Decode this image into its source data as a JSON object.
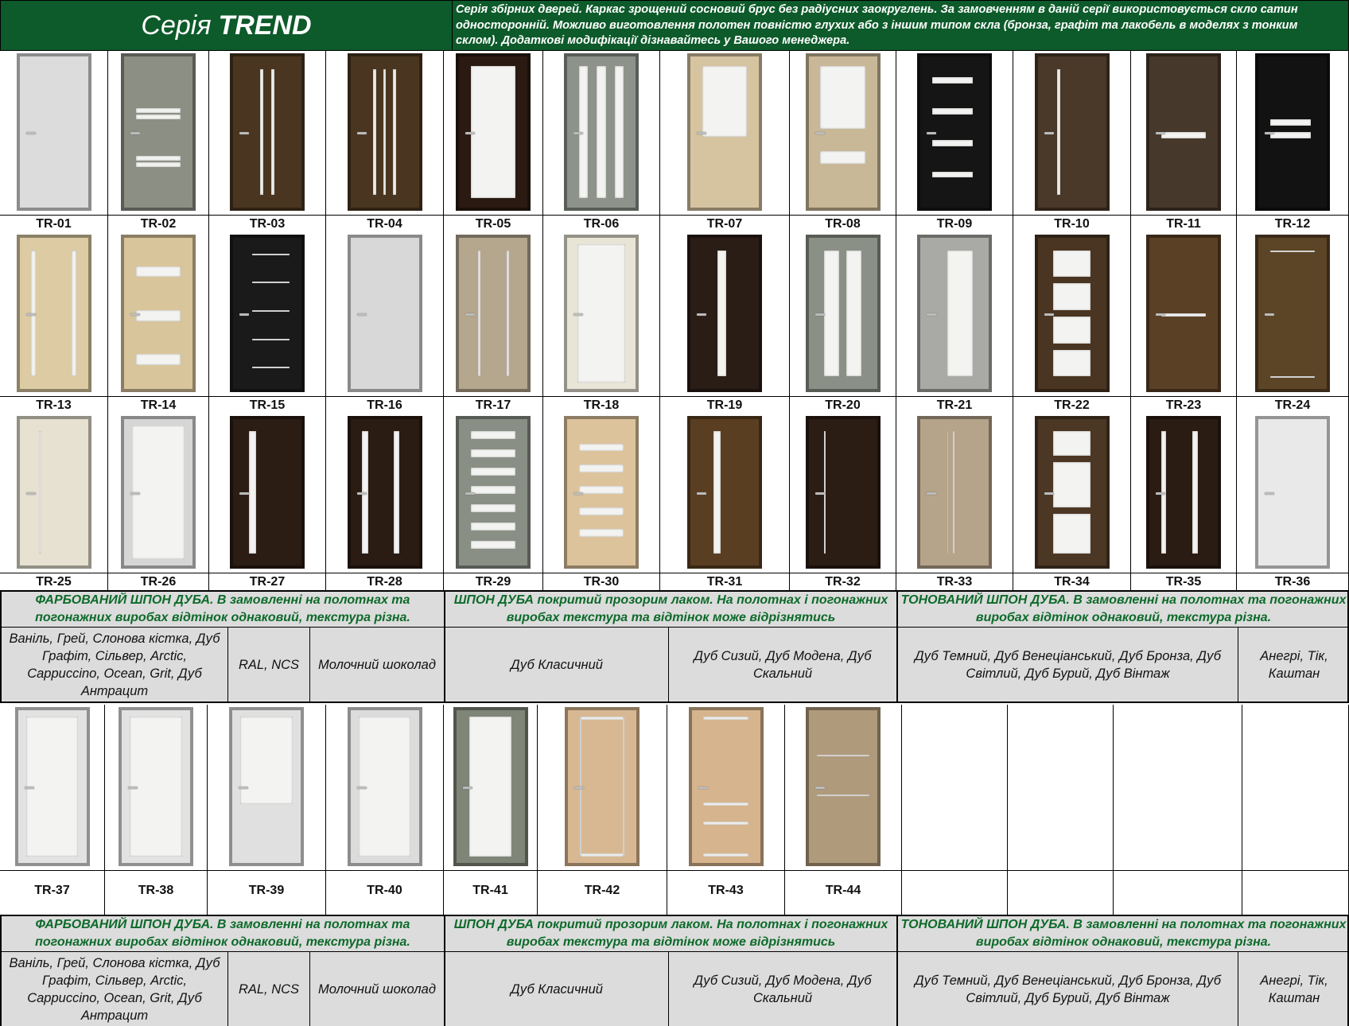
{
  "header": {
    "title_prefix": "Серія",
    "title_brand": "TREND",
    "description": "Серія збірних дверей. Каркас зрощений сосновий брус без радіусних заокруглень. За замовченням в даній серії використовується скло сатин односторонній. Можливо виготовлення полотен повністю глухих або з іншим типом скла (бронза, графіт та лакобель в моделях з тонким склом). Додаткові модифікації дізнавайтесь у Вашого менеджера."
  },
  "rows": [
    [
      "TR-01",
      "TR-02",
      "TR-03",
      "TR-04",
      "TR-05",
      "TR-06",
      "TR-07",
      "TR-08",
      "TR-09",
      "TR-10",
      "TR-11",
      "TR-12"
    ],
    [
      "TR-13",
      "TR-14",
      "TR-15",
      "TR-16",
      "TR-17",
      "TR-18",
      "TR-19",
      "TR-20",
      "TR-21",
      "TR-22",
      "TR-23",
      "TR-24"
    ],
    [
      "TR-25",
      "TR-26",
      "TR-27",
      "TR-28",
      "TR-29",
      "TR-30",
      "TR-31",
      "TR-32",
      "TR-33",
      "TR-34",
      "TR-35",
      "TR-36"
    ],
    [
      "TR-37",
      "TR-38",
      "TR-39",
      "TR-40",
      "TR-41",
      "TR-42",
      "TR-43",
      "TR-44"
    ]
  ],
  "door_colors": {
    "TR-01": "#dcdcdc",
    "TR-02": "#8c8f84",
    "TR-03": "#4a3620",
    "TR-04": "#4a3620",
    "TR-05": "#2a1a12",
    "TR-06": "#8d938a",
    "TR-07": "#d6c3a0",
    "TR-08": "#c9b897",
    "TR-09": "#151515",
    "TR-10": "#4a3828",
    "TR-11": "#46382a",
    "TR-12": "#121212",
    "TR-13": "#dccba3",
    "TR-14": "#d9c59b",
    "TR-15": "#1a1a1a",
    "TR-16": "#d8d8d8",
    "TR-17": "#b5a68e",
    "TR-18": "#e8e4d6",
    "TR-19": "#2a1d16",
    "TR-20": "#8a9086",
    "TR-21": "#a9aaa5",
    "TR-22": "#4a3522",
    "TR-23": "#5a4025",
    "TR-24": "#5c4426",
    "TR-25": "#e6e1d0",
    "TR-26": "#d6d6d6",
    "TR-27": "#2b1c14",
    "TR-28": "#2a1b13",
    "TR-29": "#8a8f85",
    "TR-30": "#dcc39c",
    "TR-31": "#5a3e22",
    "TR-32": "#2b1c14",
    "TR-33": "#b5a38a",
    "TR-34": "#4c3725",
    "TR-35": "#2a1b13",
    "TR-36": "#e9e9e9",
    "TR-37": "#e2e2e2",
    "TR-38": "#e2e2e2",
    "TR-39": "#e0e0e0",
    "TR-40": "#dcdcdc",
    "TR-41": "#7f8577",
    "TR-42": "#d8b892",
    "TR-43": "#d6b48d",
    "TR-44": "#b09a7c"
  },
  "legend": {
    "headers": [
      "ФАРБОВАНИЙ ШПОН ДУБА. В замовленні на полотнах та погонажних виробах відтінок однаковий, текстура різна.",
      "ШПОН ДУБА покритий прозорим лаком. На полотнах і погонажних виробах текстура та відтінок може відрізнятись",
      "ТОНОВАНИЙ ШПОН ДУБА. В замовленні на полотнах та погонажних виробах відтінок однаковий, текстура різна."
    ],
    "cells": [
      "Ваніль, Грей, Слонова кістка, Дуб Графіт, Сільвер, Arctic, Cappuccino, Ocean, Grit,  Дуб Антрацит",
      "RAL, NCS",
      "Молочний шоколад",
      "Дуб Класичний",
      "Дуб Сизий, Дуб Модена, Дуб Скальний",
      "Дуб Темний, Дуб Венеціанський, Дуб Бронза, Дуб Світлий, Дуб Бурий, Дуб Вінтаж",
      "Анегрі, Тік, Каштан"
    ]
  }
}
